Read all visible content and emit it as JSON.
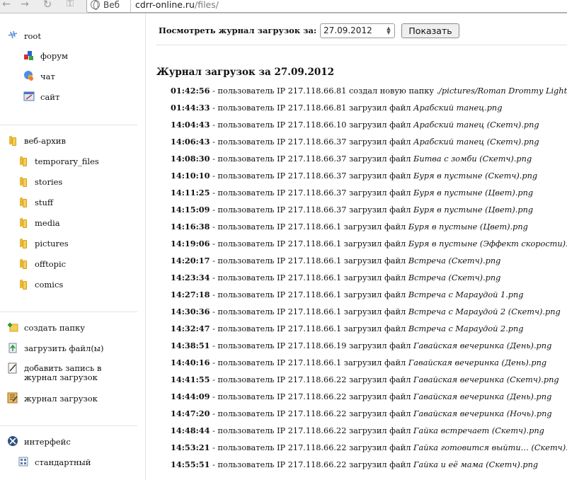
{
  "browser": {
    "identity_label": "Веб",
    "url_host": "cdrr-online.ru",
    "url_path": "/files/"
  },
  "sidebar": {
    "main_nav": [
      {
        "label": "root",
        "icon": "root-icon"
      },
      {
        "label": "форум",
        "icon": "forum-icon"
      },
      {
        "label": "чат",
        "icon": "chat-icon"
      },
      {
        "label": "сайт",
        "icon": "site-icon"
      }
    ],
    "archive": {
      "label": "веб-архив",
      "icon": "folder-icon"
    },
    "folders": [
      {
        "label": "temporary_files"
      },
      {
        "label": "stories"
      },
      {
        "label": "stuff"
      },
      {
        "label": "media"
      },
      {
        "label": "pictures"
      },
      {
        "label": "offtopic"
      },
      {
        "label": "comics"
      }
    ],
    "actions": [
      {
        "label": "создать папку",
        "icon": "create-folder-icon"
      },
      {
        "label": "загрузить файл(ы)",
        "icon": "upload-icon"
      },
      {
        "label_line1": "добавить запись в",
        "label_line2": "журнал загрузок",
        "icon": "add-entry-icon"
      },
      {
        "label": "журнал загрузок",
        "icon": "log-icon"
      }
    ],
    "interface": {
      "label": "интерфейс",
      "icon": "interface-icon"
    },
    "interface_options": [
      {
        "label": "стандартный",
        "icon": "grid-icon"
      }
    ]
  },
  "main": {
    "controls_label": "Посмотреть журнал загрузок за:",
    "date_value": "27.09.2012",
    "show_button": "Показать",
    "log_title": "Журнал загрузок за 27.09.2012",
    "log": [
      {
        "time": "01:42:56",
        "text": " - пользователь IP 217.118.66.81 создал новую папку ",
        "file": "./pictures/Roman Drommy Lighty"
      },
      {
        "time": "01:44:33",
        "text": " - пользователь IP 217.118.66.81 загрузил файл ",
        "file": "Арабский танец.png"
      },
      {
        "time": "14:04:43",
        "text": " - пользователь IP 217.118.66.10 загрузил файл ",
        "file": "Арабский танец (Скетч).png"
      },
      {
        "time": "14:06:43",
        "text": " - пользователь IP 217.118.66.37 загрузил файл ",
        "file": "Арабский танец (Скетч).png"
      },
      {
        "time": "14:08:30",
        "text": " - пользователь IP 217.118.66.37 загрузил файл ",
        "file": "Битва с зомби (Скетч).png"
      },
      {
        "time": "14:10:10",
        "text": " - пользователь IP 217.118.66.37 загрузил файл ",
        "file": "Буря в пустыне (Скетч).png"
      },
      {
        "time": "14:11:25",
        "text": " - пользователь IP 217.118.66.37 загрузил файл ",
        "file": "Буря в пустыне (Цвет).png"
      },
      {
        "time": "14:15:09",
        "text": " - пользователь IP 217.118.66.37 загрузил файл ",
        "file": "Буря в пустыне (Цвет).png"
      },
      {
        "time": "14:16:38",
        "text": " - пользователь IP 217.118.66.1 загрузил файл ",
        "file": "Буря в пустыне (Цвет).png"
      },
      {
        "time": "14:19:06",
        "text": " - пользователь IP 217.118.66.1 загрузил файл ",
        "file": "Буря в пустыне (Эффект скорости).p"
      },
      {
        "time": "14:20:17",
        "text": " - пользователь IP 217.118.66.1 загрузил файл ",
        "file": "Встреча (Скетч).png"
      },
      {
        "time": "14:23:34",
        "text": " - пользователь IP 217.118.66.1 загрузил файл ",
        "file": "Встреча (Скетч).png"
      },
      {
        "time": "14:27:18",
        "text": " - пользователь IP 217.118.66.1 загрузил файл ",
        "file": "Встреча с Марaудой 1.png"
      },
      {
        "time": "14:30:36",
        "text": " - пользователь IP 217.118.66.1 загрузил файл ",
        "file": "Встреча с Марaудой 2 (Скетч).png"
      },
      {
        "time": "14:32:47",
        "text": " - пользователь IP 217.118.66.1 загрузил файл ",
        "file": "Встреча с Марaудой 2.png"
      },
      {
        "time": "14:38:51",
        "text": " - пользователь IP 217.118.66.19 загрузил файл ",
        "file": "Гавайская вечеринка (День).png"
      },
      {
        "time": "14:40:16",
        "text": " - пользователь IP 217.118.66.1 загрузил файл ",
        "file": "Гавайская вечеринка (День).png"
      },
      {
        "time": "14:41:55",
        "text": " - пользователь IP 217.118.66.22 загрузил файл ",
        "file": "Гавайская вечеринка (Скетч).png"
      },
      {
        "time": "14:44:09",
        "text": " - пользователь IP 217.118.66.22 загрузил файл ",
        "file": "Гавайская вечеринка (День).png"
      },
      {
        "time": "14:47:20",
        "text": " - пользователь IP 217.118.66.22 загрузил файл ",
        "file": "Гавайская вечеринка (Ночь).png"
      },
      {
        "time": "14:48:44",
        "text": " - пользователь IP 217.118.66.22 загрузил файл ",
        "file": "Гайка встречает (Скетч).png"
      },
      {
        "time": "14:53:21",
        "text": " - пользователь IP 217.118.66.22 загрузил файл ",
        "file": "Гайка готовится выйти… (Скетч).p"
      },
      {
        "time": "14:55:51",
        "text": " - пользователь IP 217.118.66.22 загрузил файл ",
        "file": "Гайка и её мама (Скетч).png"
      }
    ]
  }
}
